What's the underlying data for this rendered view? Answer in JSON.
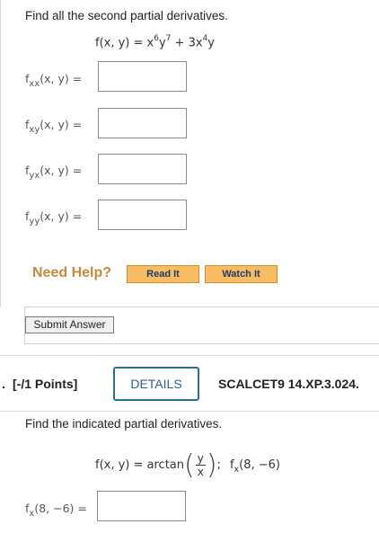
{
  "q1": {
    "prompt": "Find all the second partial derivatives.",
    "function_lhs": "f(x, y) = x",
    "exp1": "6",
    "y_var": "y",
    "exp2": "7",
    "mid": " + 3x",
    "exp3": "4",
    "end": "y",
    "rows": [
      {
        "f": "f",
        "sub": "xx",
        "rest": "(x, y)  ="
      },
      {
        "f": "f",
        "sub": "xy",
        "rest": "(x, y)  ="
      },
      {
        "f": "f",
        "sub": "yx",
        "rest": "(x, y)  ="
      },
      {
        "f": "f",
        "sub": "yy",
        "rest": "(x, y)  ="
      }
    ],
    "need_help": "Need Help?",
    "read_it": "Read It",
    "watch_it": "Watch It",
    "submit": "Submit Answer"
  },
  "q2": {
    "number_prefix": ".",
    "points": "[-/1 Points]",
    "details": "DETAILS",
    "code": "SCALCET9 14.XP.3.024.",
    "prompt": "Find the indicated partial derivatives.",
    "func_lhs": "f(x, y) = arctan",
    "frac_num": "y",
    "frac_den": "x",
    "after": ";",
    "target_f": "f",
    "target_sub": "x",
    "target_args": "(8, −6)",
    "answer_label_f": "f",
    "answer_label_sub": "x",
    "answer_label_rest": "(8, −6) ="
  }
}
